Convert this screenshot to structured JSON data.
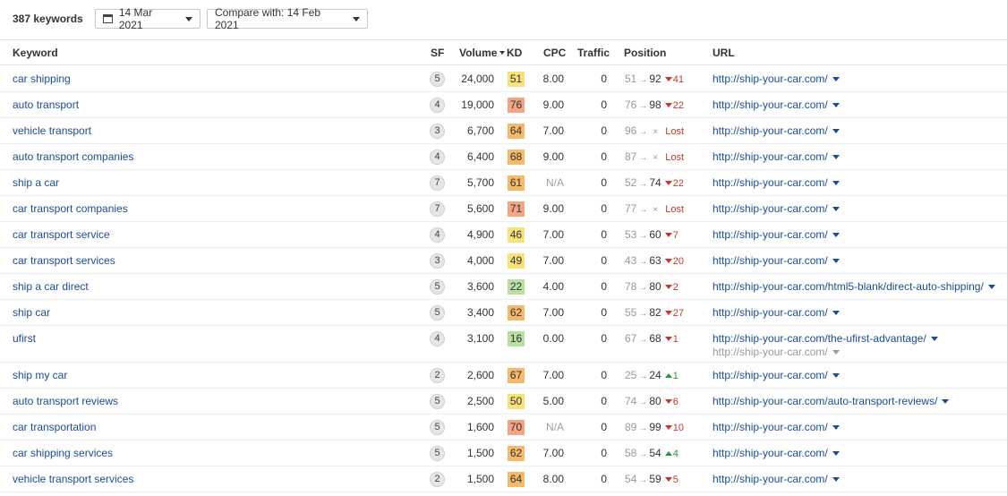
{
  "toolbar": {
    "keyword_count": "387 keywords",
    "date_label": "14 Mar 2021",
    "compare_label": "Compare with: 14 Feb 2021"
  },
  "columns": {
    "keyword": "Keyword",
    "sf": "SF",
    "volume": "Volume",
    "kd": "KD",
    "cpc": "CPC",
    "traffic": "Traffic",
    "position": "Position",
    "url": "URL"
  },
  "sort": {
    "column": "volume",
    "direction": "desc"
  },
  "colors": {
    "link": "#1a4c9c",
    "kd_green": "#b6dfa0",
    "kd_yellow": "#f7e27a",
    "kd_orange": "#f5b96b",
    "kd_red": "#f2a484",
    "change_down": "#c0392b",
    "change_up": "#27923a"
  },
  "rows": [
    {
      "keyword": "car shipping",
      "sf": "5",
      "volume": "24,000",
      "kd": "51",
      "kd_color": "#f7e27a",
      "cpc": "8.00",
      "traffic": "0",
      "pos_old": "51",
      "pos_new": "92",
      "change": "41",
      "change_dir": "down",
      "url": "http://ship-your-car.com/"
    },
    {
      "keyword": "auto transport",
      "sf": "4",
      "volume": "19,000",
      "kd": "76",
      "kd_color": "#f2a484",
      "cpc": "9.00",
      "traffic": "0",
      "pos_old": "76",
      "pos_new": "98",
      "change": "22",
      "change_dir": "down",
      "url": "http://ship-your-car.com/"
    },
    {
      "keyword": "vehicle transport",
      "sf": "3",
      "volume": "6,700",
      "kd": "64",
      "kd_color": "#f5b96b",
      "cpc": "7.00",
      "traffic": "0",
      "pos_old": "96",
      "pos_new": "×",
      "change": "Lost",
      "change_dir": "lost",
      "url": "http://ship-your-car.com/"
    },
    {
      "keyword": "auto transport companies",
      "sf": "4",
      "volume": "6,400",
      "kd": "68",
      "kd_color": "#f5b96b",
      "cpc": "9.00",
      "traffic": "0",
      "pos_old": "87",
      "pos_new": "×",
      "change": "Lost",
      "change_dir": "lost",
      "url": "http://ship-your-car.com/"
    },
    {
      "keyword": "ship a car",
      "sf": "7",
      "volume": "5,700",
      "kd": "61",
      "kd_color": "#f5b96b",
      "cpc": "N/A",
      "traffic": "0",
      "pos_old": "52",
      "pos_new": "74",
      "change": "22",
      "change_dir": "down",
      "url": "http://ship-your-car.com/"
    },
    {
      "keyword": "car transport companies",
      "sf": "7",
      "volume": "5,600",
      "kd": "71",
      "kd_color": "#f2a484",
      "cpc": "9.00",
      "traffic": "0",
      "pos_old": "77",
      "pos_new": "×",
      "change": "Lost",
      "change_dir": "lost",
      "url": "http://ship-your-car.com/"
    },
    {
      "keyword": "car transport service",
      "sf": "4",
      "volume": "4,900",
      "kd": "46",
      "kd_color": "#f7e27a",
      "cpc": "7.00",
      "traffic": "0",
      "pos_old": "53",
      "pos_new": "60",
      "change": "7",
      "change_dir": "down",
      "url": "http://ship-your-car.com/"
    },
    {
      "keyword": "car transport services",
      "sf": "3",
      "volume": "4,000",
      "kd": "49",
      "kd_color": "#f7e27a",
      "cpc": "7.00",
      "traffic": "0",
      "pos_old": "43",
      "pos_new": "63",
      "change": "20",
      "change_dir": "down",
      "url": "http://ship-your-car.com/"
    },
    {
      "keyword": "ship a car direct",
      "sf": "5",
      "volume": "3,600",
      "kd": "22",
      "kd_color": "#b6dfa0",
      "cpc": "4.00",
      "traffic": "0",
      "pos_old": "78",
      "pos_new": "80",
      "change": "2",
      "change_dir": "down",
      "url": "http://ship-your-car.com/html5-blank/direct-auto-shipping/"
    },
    {
      "keyword": "ship car",
      "sf": "5",
      "volume": "3,400",
      "kd": "62",
      "kd_color": "#f5b96b",
      "cpc": "7.00",
      "traffic": "0",
      "pos_old": "55",
      "pos_new": "82",
      "change": "27",
      "change_dir": "down",
      "url": "http://ship-your-car.com/"
    },
    {
      "keyword": "ufirst",
      "sf": "4",
      "volume": "3,100",
      "kd": "16",
      "kd_color": "#b6dfa0",
      "cpc": "0.00",
      "traffic": "0",
      "pos_old": "67",
      "pos_new": "68",
      "change": "1",
      "change_dir": "down",
      "url": "http://ship-your-car.com/the-ufirst-advantage/",
      "url_secondary": "http://ship-your-car.com/"
    },
    {
      "keyword": "ship my car",
      "sf": "2",
      "volume": "2,600",
      "kd": "67",
      "kd_color": "#f5b96b",
      "cpc": "7.00",
      "traffic": "0",
      "pos_old": "25",
      "pos_new": "24",
      "change": "1",
      "change_dir": "up",
      "url": "http://ship-your-car.com/"
    },
    {
      "keyword": "auto transport reviews",
      "sf": "5",
      "volume": "2,500",
      "kd": "50",
      "kd_color": "#f7e27a",
      "cpc": "5.00",
      "traffic": "0",
      "pos_old": "74",
      "pos_new": "80",
      "change": "6",
      "change_dir": "down",
      "url": "http://ship-your-car.com/auto-transport-reviews/"
    },
    {
      "keyword": "car transportation",
      "sf": "5",
      "volume": "1,600",
      "kd": "70",
      "kd_color": "#f2a484",
      "cpc": "N/A",
      "traffic": "0",
      "pos_old": "89",
      "pos_new": "99",
      "change": "10",
      "change_dir": "down",
      "url": "http://ship-your-car.com/"
    },
    {
      "keyword": "car shipping services",
      "sf": "5",
      "volume": "1,500",
      "kd": "62",
      "kd_color": "#f5b96b",
      "cpc": "7.00",
      "traffic": "0",
      "pos_old": "58",
      "pos_new": "54",
      "change": "4",
      "change_dir": "up",
      "url": "http://ship-your-car.com/"
    },
    {
      "keyword": "vehicle transport services",
      "sf": "2",
      "volume": "1,500",
      "kd": "64",
      "kd_color": "#f5b96b",
      "cpc": "8.00",
      "traffic": "0",
      "pos_old": "54",
      "pos_new": "59",
      "change": "5",
      "change_dir": "down",
      "url": "http://ship-your-car.com/"
    }
  ]
}
